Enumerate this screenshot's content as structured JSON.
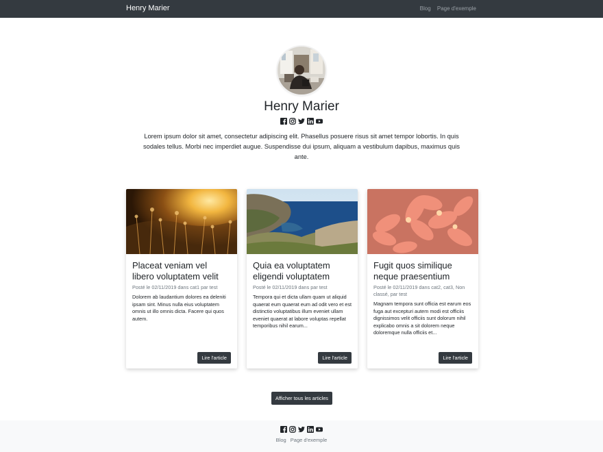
{
  "nav": {
    "brand": "Henry Marier",
    "links": [
      "Blog",
      "Page d'exemple"
    ]
  },
  "profile": {
    "name": "Henry Marier",
    "bio": "Lorem ipsum dolor sit amet, consectetur adipiscing elit. Phasellus posuere risus sit amet tempor lobortis. In quis sodales tellus. Morbi nec imperdiet augue. Suspendisse dui ipsum, aliquam a vestibulum dapibus, maximus quis ante."
  },
  "social_icons": [
    "facebook-icon",
    "instagram-icon",
    "twitter-icon",
    "linkedin-icon",
    "youtube-icon"
  ],
  "cards": [
    {
      "title": "Placeat veniam vel libero voluptatem velit",
      "meta": "Posté le 02/11/2019 dans cat1 par test",
      "excerpt": "Dolorem ab laudantium dolores ea deleniti ipsam sint. Minus nulla eius voluptatem omnis ut illo omnis dicta. Facere qui quos autem.",
      "button": "Lire l'article"
    },
    {
      "title": "Quia ea voluptatem eligendi voluptatem",
      "meta": "Posté le 02/11/2019 dans par test",
      "excerpt": "Tempora qui et dicta ullam quam ut aliquid quaerat eum quaerat eum ad odit vero et est distinctio voluptatibus illum eveniet ullam eveniet quaerat at labore voluptas repellat temporibus nihil earum...",
      "button": "Lire l'article"
    },
    {
      "title": "Fugit quos similique neque praesentium",
      "meta": "Posté le 02/11/2019 dans cat2, cat3, Non classé, par test",
      "excerpt": "Magnam tempora sunt officia est earum eos fuga aut excepturi autem modi est officiis dignissimos velit officiis sunt dolorum nihil explicabo omnis a sit dolorem neque doloremque nulla officiis et...",
      "button": "Lire l'article"
    }
  ],
  "all_articles_button": "Afficher tous les articles",
  "footer": {
    "links": [
      "Blog",
      "Page d'exemple"
    ]
  },
  "colors": {
    "navbar": "#343a40",
    "button": "#343a40",
    "footer_bg": "#f8f9fa"
  }
}
